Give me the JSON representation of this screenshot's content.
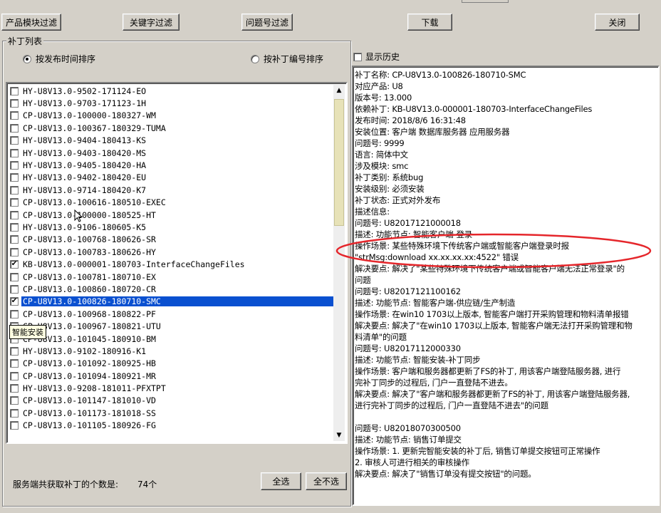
{
  "toolbar": {
    "product_filter": "产品模块过滤",
    "keyword_filter": "关键字过滤",
    "issue_filter": "问题号过滤",
    "download": "下载",
    "close": "关闭"
  },
  "patch_group": {
    "label": "补丁列表",
    "sort_by_date": "按发布时间排序",
    "sort_by_number": "按补丁编号排序",
    "selected_sort": "sort_by_date"
  },
  "patches": [
    {
      "name": "HY-U8V13.0-9502-171124-EO",
      "checked": false,
      "selected": false
    },
    {
      "name": "HY-U8V13.0-9703-171123-1H",
      "checked": false,
      "selected": false
    },
    {
      "name": "CP-U8V13.0-100000-180327-WM",
      "checked": false,
      "selected": false
    },
    {
      "name": "CP-U8V13.0-100367-180329-TUMA",
      "checked": false,
      "selected": false
    },
    {
      "name": "HY-U8V13.0-9404-180413-KS",
      "checked": false,
      "selected": false
    },
    {
      "name": "HY-U8V13.0-9403-180420-MS",
      "checked": false,
      "selected": false
    },
    {
      "name": "HY-U8V13.0-9405-180420-HA",
      "checked": false,
      "selected": false
    },
    {
      "name": "HY-U8V13.0-9402-180420-EU",
      "checked": false,
      "selected": false
    },
    {
      "name": "HY-U8V13.0-9714-180420-K7",
      "checked": false,
      "selected": false
    },
    {
      "name": "CP-U8V13.0-100616-180510-EXEC",
      "checked": false,
      "selected": false
    },
    {
      "name": "CP-U8V13.0-100000-180525-HT",
      "checked": false,
      "selected": false
    },
    {
      "name": "HY-U8V13.0-9106-180605-K5",
      "checked": false,
      "selected": false
    },
    {
      "name": "CP-U8V13.0-100768-180626-SR",
      "checked": false,
      "selected": false
    },
    {
      "name": "CP-U8V13.0-100783-180626-HY",
      "checked": false,
      "selected": false
    },
    {
      "name": "KB-U8V13.0-000001-180703-InterfaceChangeFiles",
      "checked": true,
      "selected": false
    },
    {
      "name": "CP-U8V13.0-100781-180710-EX",
      "checked": false,
      "selected": false
    },
    {
      "name": "CP-U8V13.0-100860-180720-CR",
      "checked": false,
      "selected": false
    },
    {
      "name": "CP-U8V13.0-100826-180710-SMC",
      "checked": true,
      "selected": true
    },
    {
      "name": "CP-U8V13.0-100968-180822-PF",
      "checked": false,
      "selected": false
    },
    {
      "name": "CP-U8V13.0-100967-180821-UTU",
      "checked": false,
      "selected": false
    },
    {
      "name": "CP-U8V13.0-101045-180910-BM",
      "checked": false,
      "selected": false
    },
    {
      "name": "HY-U8V13.0-9102-180916-K1",
      "checked": false,
      "selected": false
    },
    {
      "name": "CP-U8V13.0-101092-180925-HB",
      "checked": false,
      "selected": false
    },
    {
      "name": "CP-U8V13.0-101094-180921-MR",
      "checked": false,
      "selected": false
    },
    {
      "name": "HY-U8V13.0-9208-181011-PFXTPT",
      "checked": false,
      "selected": false
    },
    {
      "name": "CP-U8V13.0-101147-181010-VD",
      "checked": false,
      "selected": false
    },
    {
      "name": "CP-U8V13.0-101173-181018-SS",
      "checked": false,
      "selected": false
    },
    {
      "name": "CP-U8V13.0-101105-180926-FG",
      "checked": false,
      "selected": false
    }
  ],
  "tooltip": "智能安装",
  "footer": {
    "count_label": "服务端共获取补丁的个数是:",
    "count_value": "74个",
    "select_all": "全选",
    "deselect_all": "全不选"
  },
  "history": {
    "label": "显示历史",
    "checked": false
  },
  "details": [
    "补丁名称: CP-U8V13.0-100826-180710-SMC",
    "对应产品: U8",
    "    版本号: 13.000",
    "依赖补丁: KB-U8V13.0-000001-180703-InterfaceChangeFiles",
    "发布时间: 2018/8/6 16:31:48",
    "安装位置: 客户端 数据库服务器 应用服务器",
    "    问题号: 9999",
    "        语言: 简体中文",
    "涉及模块: smc",
    "补丁类别: 系统bug",
    "安装级别: 必须安装",
    "补丁状态: 正式对外发布",
    "描述信息:",
    "问题号: U82017121000018",
    "  描述: 功能节点:  智能客户端-登录",
    "操作场景:  某些特殊环境下传统客户端或智能客户端登录时报",
    "\"strMsg:download xx.xx.xx.xx:4522\" 错误",
    "解决要点: 解决了\"某些特殊环境下传统客户端或智能客户端无法正常登录\"的",
    "问题",
    "问题号: U82017121100162",
    "  描述: 功能节点:  智能客户端-供应链/生产制造",
    "操作场景:  在win10 1703以上版本, 智能客户端打开采购管理和物料清单报错",
    "解决要点: 解决了\"在win10 1703以上版本, 智能客户端无法打开采购管理和物",
    "料清单\"的问题",
    "问题号: U82017112000330",
    "  描述: 功能节点:  智能安装-补丁同步",
    "操作场景:  客户端和服务器都更新了FS的补丁, 用该客户端登陆服务器, 进行",
    "完补丁同步的过程后, 门户一直登陆不进去。",
    "解决要点: 解决了\"客户端和服务器都更新了FS的补丁, 用该客户端登陆服务器,",
    "进行完补丁同步的过程后, 门户一直登陆不进去\"的问题",
    "",
    "问题号: U82018070300500",
    "  描述: 功能节点:  销售订单提交",
    "操作场景:  1. 更新完智能安装的补丁后, 销售订单提交按钮可正常操作",
    "2. 审核人可进行相关的审核操作",
    "解决要点: 解决了\"销售订单没有提交按钮\"的问题。"
  ],
  "colors": {
    "selection": "#0a50d0",
    "annotation": "#e5262b",
    "window_bg": "#d4d0c8"
  }
}
